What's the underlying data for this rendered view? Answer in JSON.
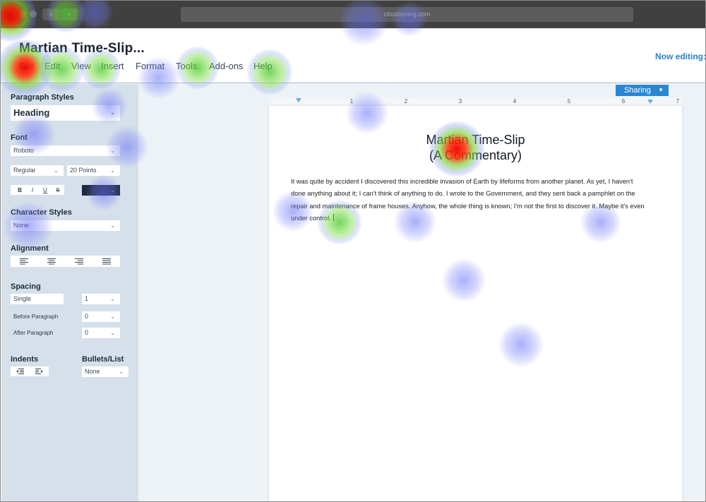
{
  "browser": {
    "url": "cloudspring.com",
    "back_icon": "chevron-left-icon",
    "forward_icon": "chevron-right-icon"
  },
  "app": {
    "document_title": "Martian Time-Slip...",
    "now_editing": "Now editing:",
    "menu": [
      "File",
      "Edit",
      "View",
      "Insert",
      "Format",
      "Tools",
      "Add-ons",
      "Help"
    ],
    "sharing_label": "Sharing"
  },
  "sidebar": {
    "paragraph_styles": {
      "label": "Paragraph Styles",
      "value": "Heading"
    },
    "font": {
      "label": "Font",
      "family": "Roboto",
      "weight": "Regular",
      "size": "20 Points"
    },
    "format_buttons": [
      "B",
      "I",
      "U",
      "S"
    ],
    "text_color": "#202a3f",
    "character_styles": {
      "label": "Character Styles",
      "value": "None"
    },
    "alignment": {
      "label": "Alignment",
      "options": [
        "align-left-icon",
        "align-center-icon",
        "align-right-icon",
        "align-justify-icon"
      ]
    },
    "spacing": {
      "label": "Spacing",
      "line_spacing": "Single",
      "line_spacing_value": "1",
      "before_label": "Before Paragraph",
      "before_value": "0",
      "after_label": "After Paragraph",
      "after_value": "0"
    },
    "indents": {
      "label": "Indents",
      "icons": [
        "outdent-icon",
        "indent-icon"
      ]
    },
    "bullets": {
      "label": "Bullets/List",
      "value": "None"
    }
  },
  "ruler": {
    "numbers": [
      "1",
      "2",
      "3",
      "4",
      "5",
      "6",
      "7"
    ]
  },
  "document": {
    "title_line1": "Martian Time-Slip",
    "title_line2": "(A Commentary)",
    "lines": [
      "It was quite by accident I discovered this incredible invasion of Earth by lifeforms from another planet. As yet, I haven't",
      "done anything about it; I can't think of anything to do. I wrote to the Government, and they sent back a pamphlet on the",
      "repair and maintenance of frame houses. Anyhow, the whole thing is known; I'm not the first to discover it. Maybe it's even",
      "under control."
    ]
  },
  "colors": {
    "chrome": "#404040",
    "accent": "#2b86d1",
    "sidebar_bg": "#d5e0ea",
    "canvas_bg": "#edf2f7",
    "heat_hot": "#eb0000",
    "heat_warm": "#46c828",
    "heat_cold": "#646ef5"
  }
}
